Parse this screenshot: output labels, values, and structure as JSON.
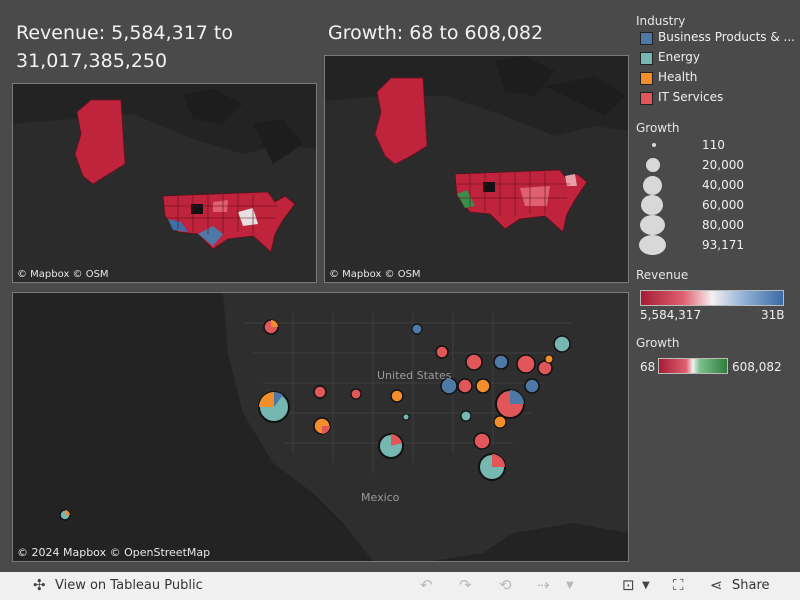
{
  "titles": {
    "revenue": "Revenue: 5,584,317 to 31,017,385,250",
    "growth": "Growth: 68 to 608,082"
  },
  "maps": {
    "attribution_small": "© Mapbox  © OSM",
    "attribution_large": "© 2024 Mapbox  © OpenStreetMap",
    "label_us": "United States",
    "label_mexico": "Mexico"
  },
  "legend": {
    "industry": {
      "title": "Industry",
      "items": [
        {
          "label": "Business Products & ...",
          "color": "#4e79a7"
        },
        {
          "label": "Energy",
          "color": "#76b7b2"
        },
        {
          "label": "Health",
          "color": "#f28e2b"
        },
        {
          "label": "IT Services",
          "color": "#e15759"
        }
      ]
    },
    "growth_size": {
      "title": "Growth",
      "items": [
        "110",
        "20,000",
        "40,000",
        "60,000",
        "80,000",
        "93,171"
      ]
    },
    "revenue": {
      "title": "Revenue",
      "min": "5,584,317",
      "max": "31B"
    },
    "growth_color": {
      "title": "Growth",
      "min": "68",
      "max": "608,082"
    }
  },
  "toolbar": {
    "view_label": "View on Tableau Public",
    "share_label": "Share"
  },
  "icons": [
    "tableau-logo-icon",
    "undo-icon",
    "redo-icon",
    "revert-icon",
    "refresh-icon",
    "download-icon",
    "fullscreen-icon",
    "share-icon"
  ]
}
